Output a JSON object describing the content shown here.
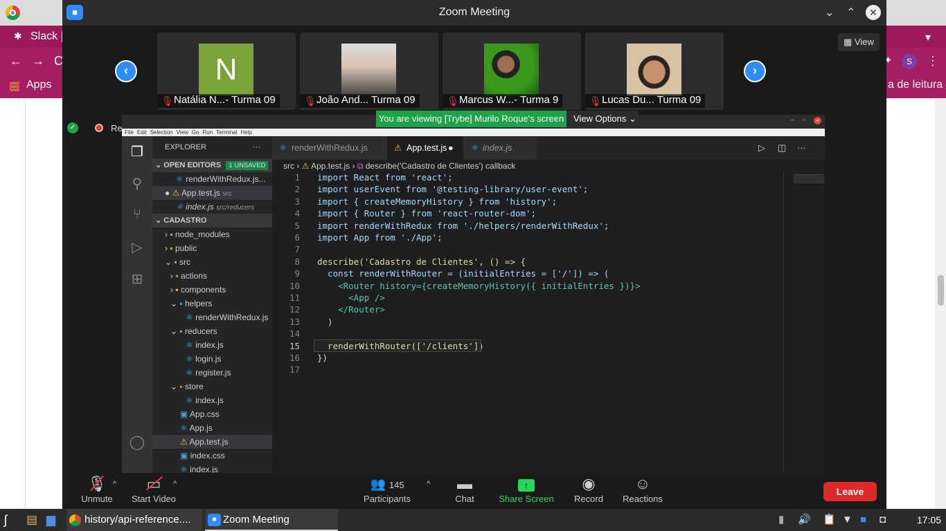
{
  "chrome": {
    "slack_tab": "Slack |",
    "bookmarks_apps": "Apps",
    "bookmark_right": "a de leitura",
    "profile_initial": "S"
  },
  "zoom": {
    "title": "Zoom Meeting",
    "view_label": "View",
    "participants": [
      {
        "name": "Natália N...- Turma 09",
        "avatar_letter": "N"
      },
      {
        "name": "João And... Turma 09"
      },
      {
        "name": "Marcus W...- Turma 9"
      },
      {
        "name": "Lucas Du... Turma 09"
      }
    ],
    "recording_label": "Recording",
    "viewing_banner": "You are viewing [Trybe] Murilo Roque's screen",
    "view_options": "View Options",
    "toolbar": {
      "unmute": "Unmute",
      "start_video": "Start Video",
      "participants_label": "Participants",
      "participants_count": "145",
      "chat": "Chat",
      "share_screen": "Share Screen",
      "record": "Record",
      "reactions": "Reactions",
      "leave": "Leave"
    }
  },
  "vscode": {
    "menu": [
      "File",
      "Edit",
      "Selection",
      "View",
      "Go",
      "Run",
      "Terminal",
      "Help"
    ],
    "explorer_title": "EXPLORER",
    "open_editors": "OPEN EDITORS",
    "unsaved_badge": "1 UNSAVED",
    "open_files": [
      {
        "name": "renderWithRedux.js...",
        "hint": ""
      },
      {
        "name": "App.test.js",
        "hint": "src"
      },
      {
        "name": "index.js",
        "hint": "src/reducers"
      }
    ],
    "project": "CADASTRO",
    "tree": [
      {
        "name": "node_modules",
        "indent": 0
      },
      {
        "name": "public",
        "indent": 0
      },
      {
        "name": "src",
        "indent": 0
      },
      {
        "name": "actions",
        "indent": 1
      },
      {
        "name": "components",
        "indent": 1
      },
      {
        "name": "helpers",
        "indent": 1
      },
      {
        "name": "renderWithRedux.js",
        "indent": 2
      },
      {
        "name": "reducers",
        "indent": 1
      },
      {
        "name": "index.js",
        "indent": 2
      },
      {
        "name": "login.js",
        "indent": 2
      },
      {
        "name": "register.js",
        "indent": 2
      },
      {
        "name": "store",
        "indent": 1
      },
      {
        "name": "index.js",
        "indent": 2
      },
      {
        "name": "App.css",
        "indent": 1
      },
      {
        "name": "App.js",
        "indent": 1
      },
      {
        "name": "App.test.js",
        "indent": 1
      },
      {
        "name": "index.css",
        "indent": 1
      },
      {
        "name": "index.js",
        "indent": 1
      }
    ],
    "tabs": [
      "renderWithRedux.js",
      "App.test.js",
      "index.js"
    ],
    "breadcrumbs": [
      "src",
      "App.test.js",
      "describe('Cadastro de Clientes') callback"
    ],
    "code_lines": [
      "import React from 'react';",
      "import userEvent from '@testing-library/user-event';",
      "import { createMemoryHistory } from 'history';",
      "import { Router } from 'react-router-dom';",
      "import renderWithRedux from './helpers/renderWithRedux';",
      "import App from './App';",
      "",
      "describe('Cadastro de Clientes', () => {",
      "  const renderWithRouter = (initialEntries = ['/']) => (",
      "    <Router history={createMemoryHistory({ initialEntries })}>",
      "      <App />",
      "    </Router>",
      "  )",
      "",
      "  renderWithRouter(['/clients'])",
      "})",
      ""
    ]
  },
  "taskbar": {
    "chrome_item": "history/api-reference....",
    "zoom_item": "Zoom Meeting",
    "clock": "17:05"
  }
}
